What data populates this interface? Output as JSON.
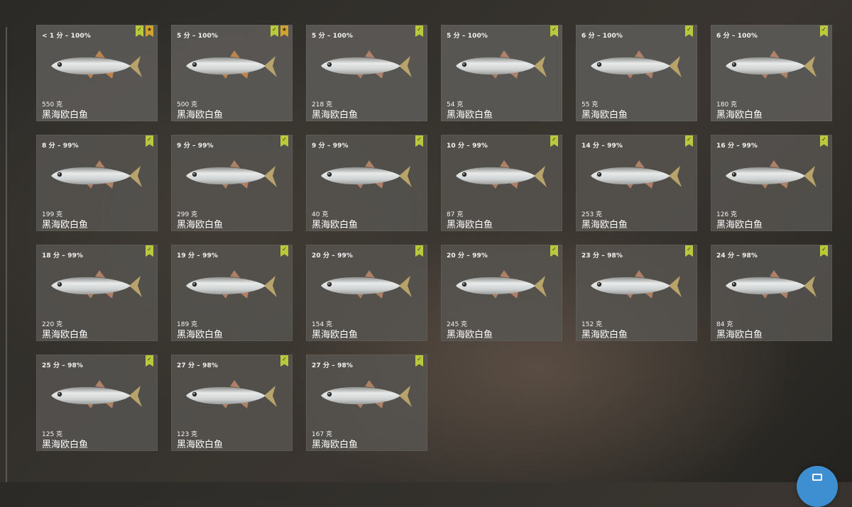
{
  "fish_name": "黑海欧白鱼",
  "catches": [
    {
      "stats": "< 1 分 – 100%",
      "weight": "550 克",
      "name": "黑海欧白鱼",
      "badges": [
        "check",
        "star"
      ],
      "fin": "#c98a4e"
    },
    {
      "stats": "5 分 – 100%",
      "weight": "500 克",
      "name": "黑海欧白鱼",
      "badges": [
        "check",
        "star"
      ],
      "fin": "#c98a4e"
    },
    {
      "stats": "5 分 – 100%",
      "weight": "218 克",
      "name": "黑海欧白鱼",
      "badges": [
        "check"
      ],
      "fin": "#b8866a"
    },
    {
      "stats": "5 分 – 100%",
      "weight": "54 克",
      "name": "黑海欧白鱼",
      "badges": [
        "check"
      ],
      "fin": "#b8866a"
    },
    {
      "stats": "6 分 – 100%",
      "weight": "55 克",
      "name": "黑海欧白鱼",
      "badges": [
        "check"
      ],
      "fin": "#b8866a"
    },
    {
      "stats": "6 分 – 100%",
      "weight": "180 克",
      "name": "黑海欧白鱼",
      "badges": [
        "check"
      ],
      "fin": "#b8866a"
    },
    {
      "stats": "8 分 – 99%",
      "weight": "199 克",
      "name": "黑海欧白鱼",
      "badges": [
        "check"
      ],
      "fin": "#b8866a"
    },
    {
      "stats": "9 分 – 99%",
      "weight": "299 克",
      "name": "黑海欧白鱼",
      "badges": [
        "check"
      ],
      "fin": "#b8866a"
    },
    {
      "stats": "9 分 – 99%",
      "weight": "40 克",
      "name": "黑海欧白鱼",
      "badges": [
        "check"
      ],
      "fin": "#b8866a"
    },
    {
      "stats": "10 分 – 99%",
      "weight": "87 克",
      "name": "黑海欧白鱼",
      "badges": [
        "check"
      ],
      "fin": "#b8866a"
    },
    {
      "stats": "14 分 – 99%",
      "weight": "253 克",
      "name": "黑海欧白鱼",
      "badges": [
        "check"
      ],
      "fin": "#b8866a"
    },
    {
      "stats": "16 分 – 99%",
      "weight": "126 克",
      "name": "黑海欧白鱼",
      "badges": [
        "check"
      ],
      "fin": "#b8866a"
    },
    {
      "stats": "18 分 – 99%",
      "weight": "220 克",
      "name": "黑海欧白鱼",
      "badges": [
        "check"
      ],
      "fin": "#b8866a"
    },
    {
      "stats": "19 分 – 99%",
      "weight": "189 克",
      "name": "黑海欧白鱼",
      "badges": [
        "check"
      ],
      "fin": "#b8866a"
    },
    {
      "stats": "20 分 – 99%",
      "weight": "154 克",
      "name": "黑海欧白鱼",
      "badges": [
        "check"
      ],
      "fin": "#b8866a"
    },
    {
      "stats": "20 分 – 99%",
      "weight": "245 克",
      "name": "黑海欧白鱼",
      "badges": [
        "check"
      ],
      "fin": "#b8866a"
    },
    {
      "stats": "23 分 – 98%",
      "weight": "152 克",
      "name": "黑海欧白鱼",
      "badges": [
        "check"
      ],
      "fin": "#b8866a"
    },
    {
      "stats": "24 分 – 98%",
      "weight": "84 克",
      "name": "黑海欧白鱼",
      "badges": [
        "check"
      ],
      "fin": "#b8866a"
    },
    {
      "stats": "25 分 – 98%",
      "weight": "125 克",
      "name": "黑海欧白鱼",
      "badges": [
        "check"
      ],
      "fin": "#b8866a"
    },
    {
      "stats": "27 分 – 98%",
      "weight": "123 克",
      "name": "黑海欧白鱼",
      "badges": [
        "check"
      ],
      "fin": "#b8866a"
    },
    {
      "stats": "27 分 – 98%",
      "weight": "167 克",
      "name": "黑海欧白鱼",
      "badges": [
        "check"
      ],
      "fin": "#b8866a"
    }
  ],
  "badge_icons": {
    "check": "checkmark-icon",
    "star": "star-icon"
  },
  "colors": {
    "badge_check": "#b9c93b",
    "badge_star": "#cfa330",
    "fab": "#3d8fd1"
  },
  "fab_icon": "message-icon"
}
